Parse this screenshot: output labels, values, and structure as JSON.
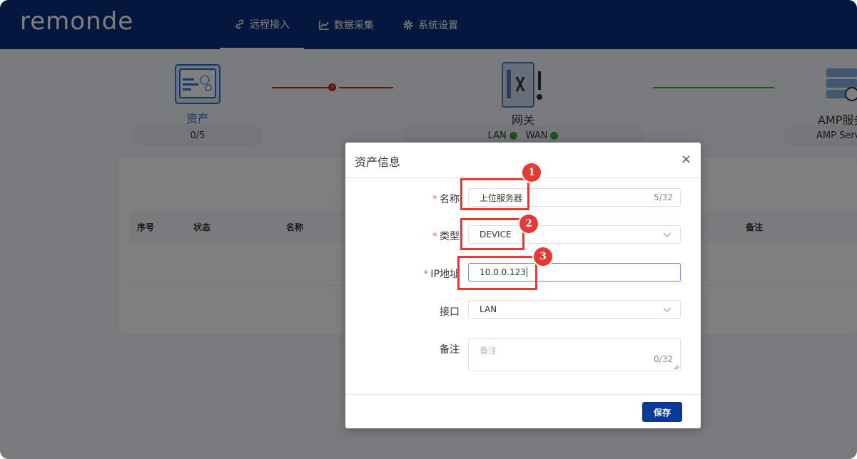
{
  "header": {
    "logo": "remonde",
    "nav": [
      {
        "label": "远程接入",
        "icon": "link-icon"
      },
      {
        "label": "数据采集",
        "icon": "chart-icon"
      },
      {
        "label": "系统设置",
        "icon": "gear-icon"
      }
    ]
  },
  "topology": {
    "asset": {
      "label": "资产",
      "count": "0/5"
    },
    "gateway": {
      "label": "网关",
      "lan": "LAN",
      "wan": "WAN"
    },
    "amp": {
      "label": "AMP服务",
      "status": "AMP Serv"
    }
  },
  "table": {
    "headers": [
      "序号",
      "状态",
      "名称",
      "备注"
    ]
  },
  "dialog": {
    "title": "资产信息",
    "close": "×",
    "fields": {
      "name": {
        "label": "名称",
        "value": "上位服务器",
        "count": "5/32"
      },
      "type": {
        "label": "类型",
        "value": "DEVICE"
      },
      "ip": {
        "label": "IP地址",
        "value": "10.0.0.123"
      },
      "port": {
        "label": "接口",
        "value": "LAN"
      },
      "note": {
        "label": "备注",
        "placeholder": "备注",
        "count": "0/32"
      }
    },
    "save_label": "保存",
    "required_mark": "*"
  },
  "annotations": [
    "1",
    "2",
    "3"
  ],
  "colors": {
    "header_bg": "#0b2f7a",
    "save_button": "#0b3a96",
    "annotation_red": "#e53935",
    "link_error": "#c62828",
    "link_ok": "#43a047",
    "asset_accent": "#2f6fd6"
  }
}
